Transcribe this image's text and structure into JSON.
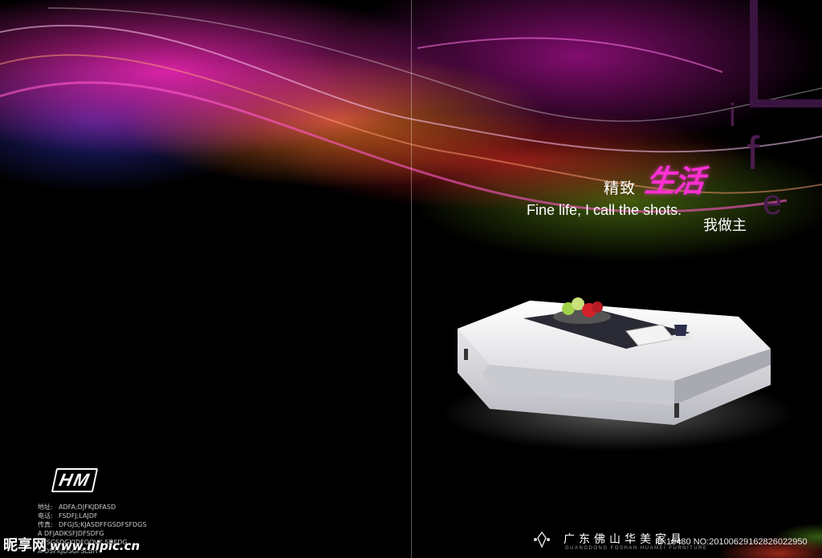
{
  "cover": {
    "deco_letters": {
      "i": "i",
      "f": "f",
      "e": "e"
    },
    "slogan": {
      "cn_part1": "精致",
      "cn_part2": "生活",
      "english": "Fine life, I call the shots.",
      "cn_part3": "我做主"
    },
    "company": {
      "name_cn": "广东佛山华美家具",
      "name_en": "GUANGDONG FOSHAN HUAMEI FURNITURE"
    }
  },
  "back": {
    "logo": "HM",
    "contact": [
      {
        "label": "地址:",
        "value": "ADFA;DJFKJDFASD"
      },
      {
        "label": "电话:",
        "value": "FSDFJ;LAJDF"
      },
      {
        "label": "传真:",
        "value": "DFGJS;KJASDFFGSDFSFDGS"
      },
      {
        "label": "",
        "value": "A DFJADKSFJDFSDFG"
      },
      {
        "label": "",
        "value": "DFSGSDGKJDFOOVK SDFDG"
      },
      {
        "label": "",
        "value": "A DSFKJDSGFSLBH"
      }
    ]
  },
  "overlay": {
    "watermark_cn": "昵享网",
    "watermark_site": "www.nipic.cn",
    "id_note": "ID:10480 NO:20100629162826022950"
  },
  "colors": {
    "accent_magenta": "#ff2fd4",
    "deco_purple": "#4a1c4d",
    "background": "#000000"
  }
}
